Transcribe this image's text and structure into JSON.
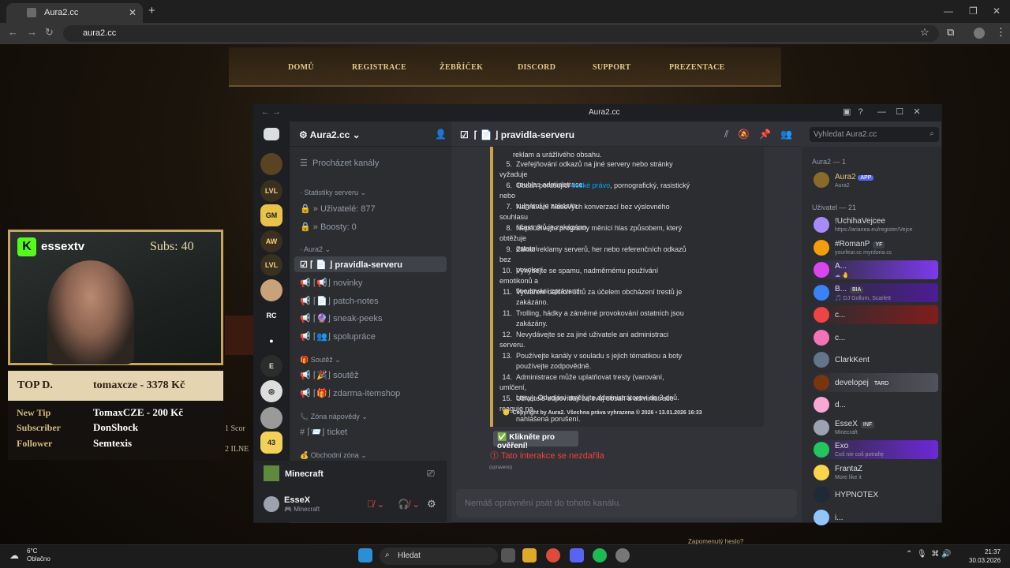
{
  "browser": {
    "tab_title": "Aura2.cc",
    "url": "aura2.cc"
  },
  "site": {
    "nav": [
      "DOMŮ",
      "REGISTRACE",
      "ŽEBŘÍČEK",
      "DISCORD",
      "SUPPORT",
      "PREZENTACE"
    ],
    "score1": "1  Scor",
    "score2": "2  ILNE",
    "forgot": "Zapomenutý heslo?"
  },
  "stream": {
    "channel": "essextv",
    "subs": "Subs: 40",
    "top_label": "TOP D.",
    "top_value": "tomaxcze - 3378 Kč",
    "rows": [
      {
        "label": "New Tip",
        "value": "TomaxCZE - 200 Kč"
      },
      {
        "label": "Subscriber",
        "value": "DonShock"
      },
      {
        "label": "Follower",
        "value": "Semtexis"
      }
    ]
  },
  "discord": {
    "window_title": "Aura2.cc",
    "server_name": "Aura2.cc ⌄",
    "guild_labels": [
      "LVL",
      "GM",
      "AW",
      "LVL",
      "RC",
      "E",
      "43",
      "E"
    ],
    "browse": "Procházet kanály",
    "stats_cat": "· Statistiky serveru ⌄",
    "users": "» Uživatelé: 877",
    "boosts": "» Boosty: 0",
    "cat_aura": "· Aura2 ⌄",
    "channels": [
      {
        "name": "⌈ 📄 ⌋ pravidla-serveru"
      },
      {
        "name": "⌈📢⌋ novinky"
      },
      {
        "name": "⌈📄⌋ patch-notes"
      },
      {
        "name": "⌈🔮⌋ sneak-peeks"
      },
      {
        "name": "⌈👥⌋ spolupráce"
      }
    ],
    "cat_soutez": "Soutěž ⌄",
    "soutez": [
      {
        "name": "⌈🎉⌋ soutěž"
      },
      {
        "name": "⌈🎁⌋ zdarma-itemshop"
      }
    ],
    "cat_help": "Zóna nápovědy ⌄",
    "ticket": "⌈📨⌋ ticket",
    "cat_trade": "Obchodní zóna ⌄",
    "activity": "Minecraft",
    "me_name": "EsseX",
    "me_status": "Minecraft",
    "channel_header": "⌈ 📄 ⌋ pravidla-serveru",
    "search": "Vyhledat Aura2.cc",
    "rules_top": "reklam a urážlivého obsahu.",
    "rules": [
      {
        "n": "5.",
        "a": "Zveřejňování odkazů na jiné servery nebo stránky vyžaduje",
        "b": "souhlas administrace."
      },
      {
        "n": "6.",
        "a": "Obsah porušující ",
        "link": "české právo",
        "a2": ", pornografický, rasistický nebo",
        "b": "vulgární je zakázán."
      },
      {
        "n": "7.",
        "a": "Nahrávání hlasových konverzací bez výslovného souhlasu",
        "b": "účastníků je zakázáno."
      },
      {
        "n": "8.",
        "a": "Nepoužívejte programy měnící hlas způsobem, který obtěžuje",
        "b": "ostatní."
      },
      {
        "n": "9.",
        "a": "Zákaz reklamy serverů, her nebo referenčních odkazů bez",
        "b": "povolení."
      },
      {
        "n": "10.",
        "a": "Vyhýbejte se spamu, nadměrnému používání emotikonů a",
        "b": "floodování zprávami."
      },
      {
        "n": "11.",
        "a": "Vytváření dalších účtů za účelem obcházení trestů je",
        "b": "zakázáno."
      },
      {
        "n": "11.",
        "a": "Trolling, hádky a záměrné provokování ostatních jsou",
        "b": "zakázány."
      },
      {
        "n": "12.",
        "a": "Nevydávejte se za jiné uživatele ani administraci serveru.",
        "b": ""
      },
      {
        "n": "13.",
        "a": "Používejte kanály v souladu s jejich tématikou a boty",
        "b": "používejte zodpovědně."
      },
      {
        "n": "14.",
        "a": "Administrace může uplatňovat tresty (varování, umlčení,",
        "b": "bany). Odvolání směřujte administrátorovi do 3 dnů."
      },
      {
        "n": "15.",
        "a": "Uživatelé odpovídají za svůj obsah a administrace reaguje na",
        "b": "nahlášená porušení."
      }
    ],
    "footer": "Copyright by Aura2. Všechna práva vyhrazena © 2026 • 13.01.2026 16:33",
    "verify": "✅ Klikněte pro ověření!",
    "failed": "Tato interakce se nezdařila",
    "edited": "(upraveno)",
    "input_placeholder": "Nemáš oprávnění psát do tohoto kanálu.",
    "members_h1": "Aura2 — 1",
    "members_h2": "Uživatel — 21",
    "bot": {
      "name": "Aura2",
      "tag": "APP",
      "status": "Aura2"
    },
    "members": [
      {
        "name": "!UchihaVejcee",
        "status": "https://arianea.eu/register/Vejce",
        "color": "#a78bfa"
      },
      {
        "name": "#RomanP",
        "tag": "YF",
        "status": "yourfear.cc myrdoria.cc",
        "color": "#f59e0b"
      },
      {
        "name": "A...",
        "tag": "",
        "status": "☁ 🤚",
        "color": "#d946ef",
        "hl": "#7c3aed"
      },
      {
        "name": "B...",
        "tag": "BIA",
        "status": "🎵 DJ Gollum, Scarlett",
        "color": "#3b82f6",
        "hl": "#4c1d95"
      },
      {
        "name": "c...",
        "tag": "",
        "status": "",
        "color": "#ef4444",
        "hl": "#7f1d1d"
      },
      {
        "name": "c...",
        "tag": "",
        "status": "",
        "color": "#f472b6"
      },
      {
        "name": "ClarkKent",
        "tag": "",
        "status": "",
        "color": "#64748b"
      },
      {
        "name": "developej",
        "tag": "TARD",
        "status": "",
        "color": "#78350f",
        "hl": "#52525b"
      },
      {
        "name": "d...",
        "tag": "",
        "status": "",
        "color": "#f9a8d4"
      },
      {
        "name": "EsseX",
        "tag": "INF",
        "status": "Minecraft",
        "color": "#9ca3af"
      },
      {
        "name": "Exo",
        "tag": "",
        "status": "Coš nie coš potrafię",
        "color": "#22c55e",
        "hl": "#6d28d9"
      },
      {
        "name": "FrantaZ",
        "tag": "",
        "status": "More like it",
        "color": "#fcd34d"
      },
      {
        "name": "HYPNOTEX",
        "tag": "",
        "status": "",
        "color": "#1f2937"
      },
      {
        "name": "i...",
        "tag": "",
        "status": "",
        "color": "#93c5fd"
      }
    ]
  },
  "taskbar": {
    "temp": "6°C",
    "weather": "Oblačno",
    "search": "Hledat",
    "time": "21:37",
    "date": "30.03.2026"
  }
}
